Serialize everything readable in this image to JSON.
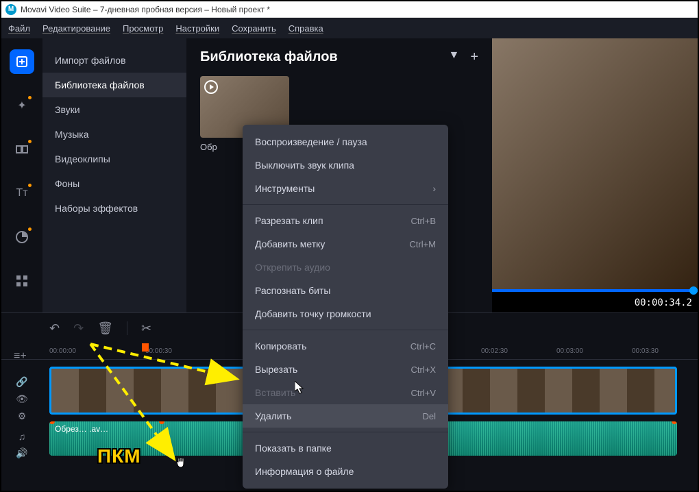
{
  "window": {
    "title": "Movavi Video Suite – 7-дневная пробная версия – Новый проект *"
  },
  "menubar": {
    "items": [
      "Файл",
      "Редактирование",
      "Просмотр",
      "Настройки",
      "Сохранить",
      "Справка"
    ]
  },
  "left_tools": {
    "icons": [
      "add-icon",
      "wand-icon",
      "transition-icon",
      "text-icon",
      "time-icon",
      "more-icon"
    ]
  },
  "sidebar": {
    "items": [
      {
        "label": "Импорт файлов"
      },
      {
        "label": "Библиотека файлов"
      },
      {
        "label": "Звуки"
      },
      {
        "label": "Музыка"
      },
      {
        "label": "Видеоклипы"
      },
      {
        "label": "Фоны"
      },
      {
        "label": "Наборы эффектов"
      }
    ],
    "active_index": 1
  },
  "content": {
    "title": "Библиотека файлов",
    "clip_label": "Обр"
  },
  "preview": {
    "time": "00:00:34.2"
  },
  "context_menu": {
    "items": [
      {
        "label": "Воспроизведение / пауза",
        "shortcut": "",
        "type": "item"
      },
      {
        "label": "Выключить звук клипа",
        "shortcut": "",
        "type": "item"
      },
      {
        "label": "Инструменты",
        "shortcut": "",
        "type": "submenu"
      },
      {
        "type": "sep"
      },
      {
        "label": "Разрезать клип",
        "shortcut": "Ctrl+B",
        "type": "item"
      },
      {
        "label": "Добавить метку",
        "shortcut": "Ctrl+M",
        "type": "item"
      },
      {
        "label": "Открепить аудио",
        "shortcut": "",
        "type": "disabled"
      },
      {
        "label": "Распознать биты",
        "shortcut": "",
        "type": "item"
      },
      {
        "label": "Добавить точку громкости",
        "shortcut": "",
        "type": "item"
      },
      {
        "type": "sep"
      },
      {
        "label": "Копировать",
        "shortcut": "Ctrl+C",
        "type": "item"
      },
      {
        "label": "Вырезать",
        "shortcut": "Ctrl+X",
        "type": "item"
      },
      {
        "label": "Вставить",
        "shortcut": "Ctrl+V",
        "type": "disabled"
      },
      {
        "label": "Удалить",
        "shortcut": "Del",
        "type": "highlight"
      },
      {
        "type": "sep"
      },
      {
        "label": "Показать в папке",
        "shortcut": "",
        "type": "item"
      },
      {
        "label": "Информация о файле",
        "shortcut": "",
        "type": "item"
      }
    ]
  },
  "timeline": {
    "ruler": [
      "00:00:00",
      "00:00:30",
      "00:02:30",
      "00:03:00",
      "00:03:30"
    ],
    "audio_label": "Обрез…              .av…"
  },
  "annotation": {
    "text": "ПКМ"
  }
}
